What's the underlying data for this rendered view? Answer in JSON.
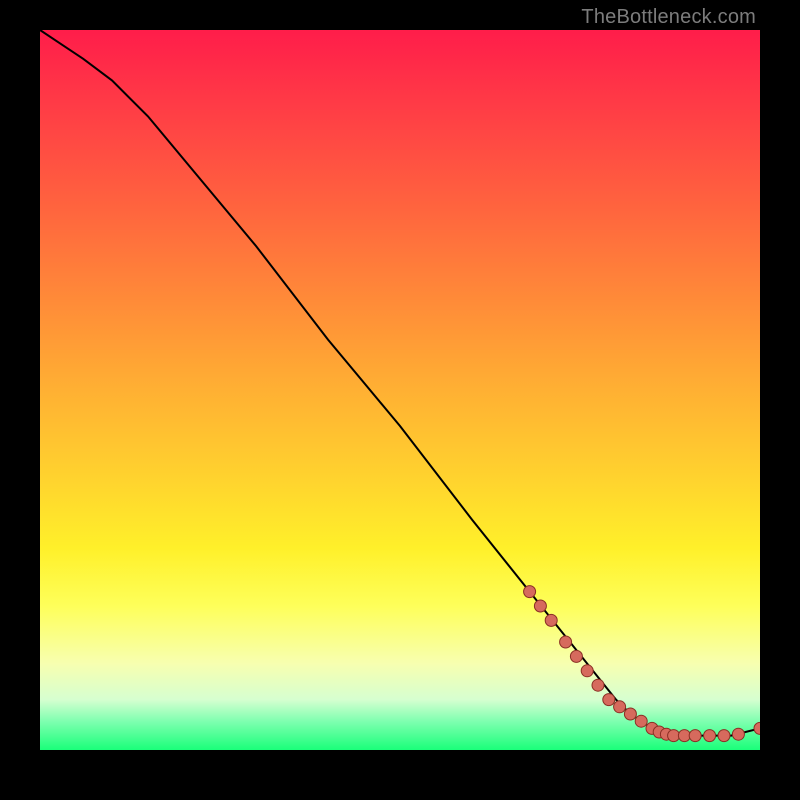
{
  "attribution": "TheBottleneck.com",
  "chart_data": {
    "type": "line",
    "title": "",
    "xlabel": "",
    "ylabel": "",
    "xlim": [
      0,
      100
    ],
    "ylim": [
      0,
      100
    ],
    "grid": false,
    "legend": false,
    "series": [
      {
        "name": "curve",
        "x": [
          0,
          3,
          6,
          10,
          15,
          20,
          30,
          40,
          50,
          60,
          68,
          72,
          76,
          80,
          82,
          85,
          88,
          92,
          96,
          100
        ],
        "y": [
          100,
          98,
          96,
          93,
          88,
          82,
          70,
          57,
          45,
          32,
          22,
          17,
          12,
          7,
          5,
          3,
          2,
          2,
          2,
          3
        ]
      }
    ],
    "markers": [
      {
        "x": 68,
        "y": 22
      },
      {
        "x": 69.5,
        "y": 20
      },
      {
        "x": 71,
        "y": 18
      },
      {
        "x": 73,
        "y": 15
      },
      {
        "x": 74.5,
        "y": 13
      },
      {
        "x": 76,
        "y": 11
      },
      {
        "x": 77.5,
        "y": 9
      },
      {
        "x": 79,
        "y": 7
      },
      {
        "x": 80.5,
        "y": 6
      },
      {
        "x": 82,
        "y": 5
      },
      {
        "x": 83.5,
        "y": 4
      },
      {
        "x": 85,
        "y": 3
      },
      {
        "x": 86,
        "y": 2.5
      },
      {
        "x": 87,
        "y": 2.2
      },
      {
        "x": 88,
        "y": 2
      },
      {
        "x": 89.5,
        "y": 2
      },
      {
        "x": 91,
        "y": 2
      },
      {
        "x": 93,
        "y": 2
      },
      {
        "x": 95,
        "y": 2
      },
      {
        "x": 97,
        "y": 2.2
      },
      {
        "x": 100,
        "y": 3
      }
    ],
    "colors": {
      "curve_stroke": "#000000",
      "marker_fill": "#d66a5d",
      "marker_stroke": "#8a2f24"
    }
  }
}
